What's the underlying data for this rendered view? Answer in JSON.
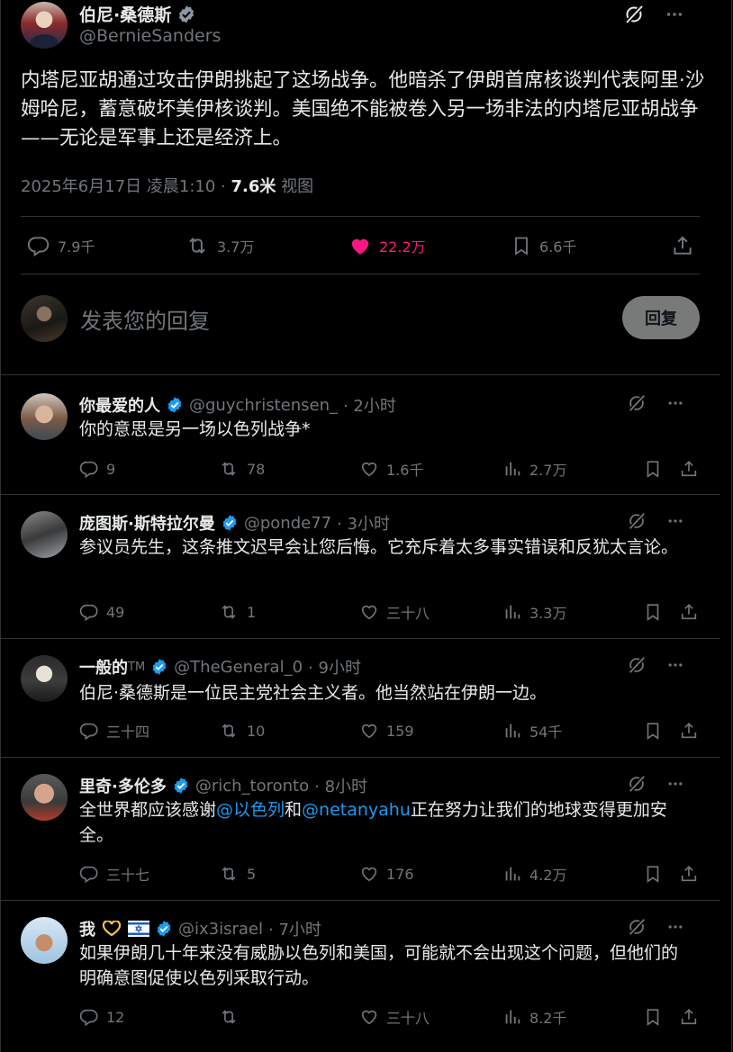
{
  "main_tweet": {
    "author_name": "伯尼·桑德斯",
    "author_handle": "@BernieSanders",
    "text": "内塔尼亚胡通过攻击伊朗挑起了这场战争。他暗杀了伊朗首席核谈判代表阿里·沙姆哈尼，蓄意破坏美伊核谈判。美国绝不能被卷入另一场非法的内塔尼亚胡战争——无论是军事上还是经济上。",
    "timestamp": "2025年6月17日 凌晨1:10 · ",
    "views_count": "7.6米",
    "views_label": " 视图",
    "replies": "7.9千",
    "retweets": "3.7万",
    "likes": "22.2万",
    "bookmarks": "6.6千"
  },
  "reply_box": {
    "placeholder": "发表您的回复",
    "button_label": "回复"
  },
  "replies": [
    {
      "name": "你最爱的人",
      "handle": "@guychristensen_",
      "time": "· 2小时",
      "text": "你的意思是另一场以色列战争*",
      "replies": "9",
      "retweets": "78",
      "likes": "1.6千",
      "views": "2.7万"
    },
    {
      "name": "庞图斯·斯特拉尔曼",
      "handle": "@ponde77",
      "time": "· 3小时",
      "text": "参议员先生，这条推文迟早会让您后悔。它充斥着太多事实错误和反犹太言论。",
      "replies": "49",
      "retweets": "1",
      "likes": "三十八",
      "views": "3.3万"
    },
    {
      "name": "一般的",
      "name_suffix": "TM",
      "handle": "@TheGeneral_0",
      "time": "· 9小时",
      "text": "伯尼·桑德斯是一位民主党社会主义者。他当然站在伊朗一边。",
      "replies": "三十四",
      "retweets": "10",
      "likes": "159",
      "views": "54千"
    },
    {
      "name": "里奇·多伦多",
      "handle": "@rich_toronto",
      "time": "· 8小时",
      "text_before": "全世界都应该感谢",
      "mention1": "@以色列",
      "text_mid": "和",
      "mention2": "@netanyahu",
      "text_after": "正在努力让我们的地球变得更加安全。",
      "replies": "三十七",
      "retweets": "5",
      "likes": "176",
      "views": "4.2万"
    },
    {
      "name": "我",
      "handle": "@ix3israel",
      "time": "· 7小时",
      "text": "如果伊朗几十年来没有威胁以色列和美国，可能就不会出现这个问题，但他们的明确意图促使以色列采取行动。",
      "replies": "12",
      "retweets": "",
      "likes": "三十八",
      "views": "8.2千"
    }
  ],
  "colors": {
    "background": "#000000",
    "text": "#e7e9ea",
    "muted": "#71767b",
    "border": "#2f3336",
    "like": "#f91880",
    "link": "#1d9bf0",
    "verified": "#1d9bf0"
  }
}
